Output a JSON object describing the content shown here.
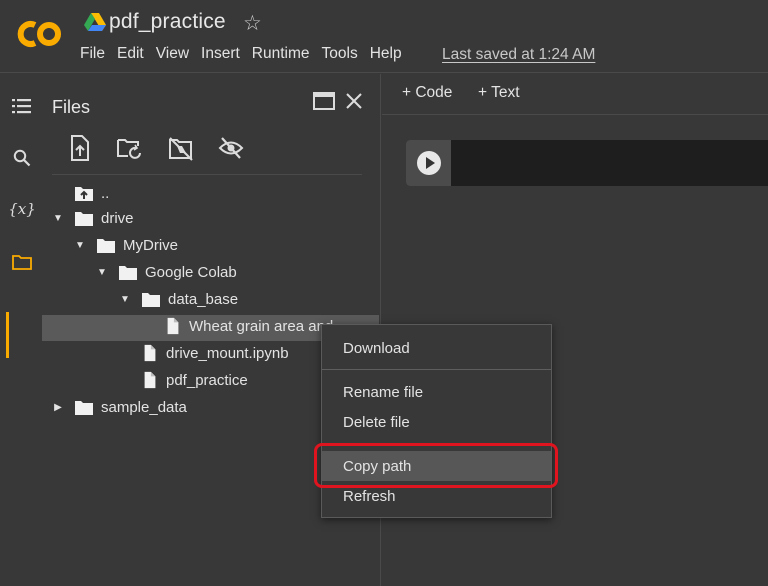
{
  "header": {
    "notebook_title": "pdf_practice",
    "last_saved": "Last saved at 1:24 AM",
    "menu": [
      "File",
      "Edit",
      "View",
      "Insert",
      "Runtime",
      "Tools",
      "Help"
    ],
    "logo_text": "CO"
  },
  "sidebar": {
    "title": "Files",
    "rail_icons": [
      "table-of-contents-icon",
      "search-icon",
      "variables-icon",
      "folder-icon"
    ],
    "toolbar_icons": [
      "upload-icon",
      "refresh-icon",
      "unmount-drive-icon",
      "hide-files-icon"
    ],
    "tree": {
      "parent": "..",
      "drive": "drive",
      "mydrive": "MyDrive",
      "google_colab": "Google Colab",
      "data_base": "data_base",
      "wheat_file": "Wheat grain area and",
      "drive_mount": "drive_mount.ipynb",
      "pdf_practice": "pdf_practice",
      "sample_data": "sample_data"
    }
  },
  "main": {
    "add_code": "+ Code",
    "add_text": "+ Text"
  },
  "context_menu": {
    "download": "Download",
    "rename": "Rename file",
    "delete": "Delete file",
    "copy_path": "Copy path",
    "refresh": "Refresh"
  },
  "colors": {
    "background": "#383838",
    "accent": "#f9ab00",
    "highlight_frame": "#e0141f"
  }
}
